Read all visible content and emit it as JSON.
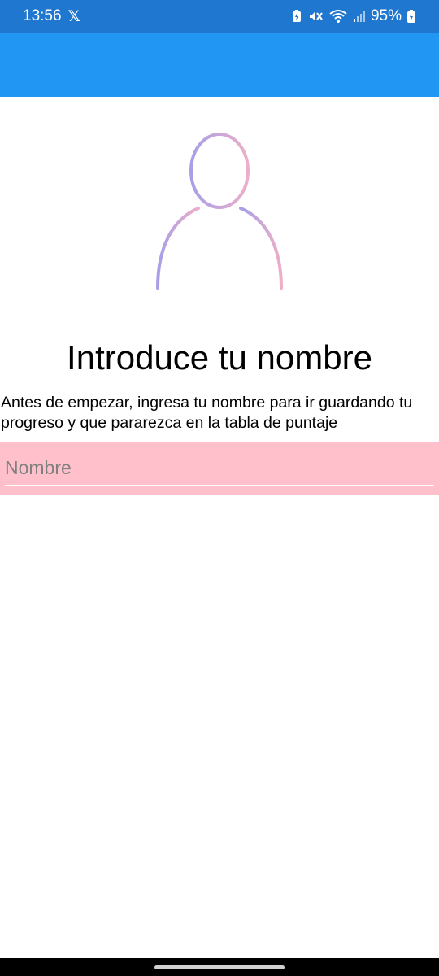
{
  "status_bar": {
    "time": "13:56",
    "notification_icon": "x-logo-icon",
    "battery_percent": "95%",
    "icons": [
      "battery-saver-icon",
      "mute-icon",
      "wifi-icon",
      "signal-icon",
      "battery-charging-icon"
    ]
  },
  "colors": {
    "status_bar": "#1f77cf",
    "app_bar": "#2196f3",
    "input_background": "#ffc0cb",
    "avatar_gradient_start": "#a79fe8",
    "avatar_gradient_end": "#eeaec8"
  },
  "avatar": {
    "icon": "user-profile-icon"
  },
  "main": {
    "title": "Introduce tu nombre",
    "description": "Antes de empezar, ingresa tu nombre para ir guardando tu progreso y que pararezca en la tabla de puntaje"
  },
  "name_input": {
    "placeholder": "Nombre",
    "value": ""
  }
}
